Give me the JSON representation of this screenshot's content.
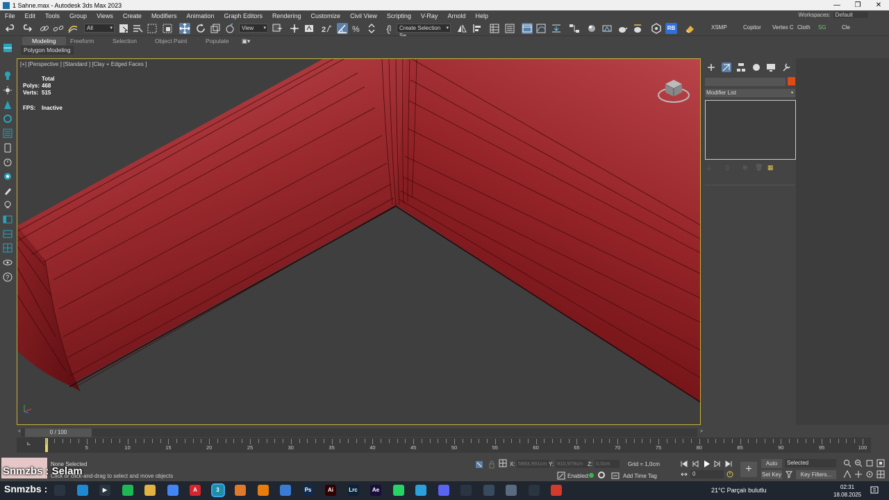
{
  "window": {
    "title": "1 Sahne.max - Autodesk 3ds Max 2023",
    "controls": [
      "—",
      "❐",
      "✕"
    ]
  },
  "menu": {
    "items": [
      "File",
      "Edit",
      "Tools",
      "Group",
      "Views",
      "Create",
      "Modifiers",
      "Animation",
      "Graph Editors",
      "Rendering",
      "Customize",
      "Civil View",
      "Scripting",
      "V-Ray",
      "Arnold",
      "Help"
    ],
    "workspaces_label": "Workspaces:",
    "workspaces_value": "Default"
  },
  "toolbar": {
    "filter_value": "All",
    "coord_system": "View",
    "named_selection": "Create Selection Se",
    "right_labels": [
      "XSMP",
      "Copitor",
      "Vertex C",
      "Cloth",
      "SG",
      "Cle"
    ],
    "rb_label": "RB"
  },
  "ribbon": {
    "tabs": [
      "Modeling",
      "Freeform",
      "Selection",
      "Object Paint",
      "Populate"
    ],
    "active_tab": "Modeling",
    "subpanel": "Polygon Modeling"
  },
  "viewport": {
    "label": "[+] [Perspective ] [Standard ] [Clay + Edged Faces ]",
    "stats": {
      "header": "Total",
      "polys_label": "Polys:",
      "polys": "468",
      "verts_label": "Verts:",
      "verts": "515",
      "fps_label": "FPS:",
      "fps": "Inactive"
    },
    "object_color": "#9b2a2e",
    "background_color": "#3f3f3f"
  },
  "command_panel": {
    "color_swatch": "#e04a14",
    "modifier_list": "Modifier List"
  },
  "timeline": {
    "slider_label": "0 / 100",
    "ticks": [
      0,
      5,
      10,
      15,
      20,
      25,
      30,
      35,
      40,
      45,
      50,
      55,
      60,
      65,
      70,
      75,
      80,
      85,
      90,
      95,
      100
    ],
    "current_frame": 0
  },
  "status": {
    "message": "None Selected",
    "hint": "Click or click-and-drag to select and move objects",
    "x_label": "X:",
    "x_value": "5893,991cm",
    "y_label": "Y:",
    "y_value": "910,979cm",
    "z_label": "Z:",
    "z_value": "0,0cm",
    "grid": "Grid = 1,0cm",
    "enabled_label": "Enabled:",
    "add_time_tag": "Add Time Tag",
    "auto_key": "Auto Key",
    "set_key": "Set Key",
    "selected_dropdown": "Selected",
    "key_filters": "Key Filters...",
    "frame_field": "0"
  },
  "overlay": {
    "line1_a": "Snmzbs",
    "line1_b": ": Selam",
    "line2": "Snmzbs :"
  },
  "taskbar": {
    "weather": "21°C  Parçalı bulutlu",
    "time": "02:31",
    "date": "18.08.2025",
    "apps": [
      {
        "name": "search",
        "color": "#2b3542",
        "label": ""
      },
      {
        "name": "edge",
        "color": "#1f8ad2",
        "label": ""
      },
      {
        "name": "media",
        "color": "#2b3542",
        "label": "▶"
      },
      {
        "name": "spotify",
        "color": "#1db954",
        "label": ""
      },
      {
        "name": "explorer",
        "color": "#e3b341",
        "label": ""
      },
      {
        "name": "chrome",
        "color": "#4285f4",
        "label": ""
      },
      {
        "name": "acrobat",
        "color": "#d4262c",
        "label": "A"
      },
      {
        "name": "3dsmax",
        "color": "#1d8ea8",
        "label": "3"
      },
      {
        "name": "sublime",
        "color": "#e07a2a",
        "label": ""
      },
      {
        "name": "blender",
        "color": "#e87d0d",
        "label": ""
      },
      {
        "name": "vmware",
        "color": "#3a7bd5",
        "label": ""
      },
      {
        "name": "photoshop",
        "color": "#0f2a4a",
        "label": "Ps"
      },
      {
        "name": "illustrator",
        "color": "#300",
        "label": "Ai"
      },
      {
        "name": "lightroom",
        "color": "#0b2238",
        "label": "Lrc"
      },
      {
        "name": "aftereffects",
        "color": "#1a0d3a",
        "label": "Ae"
      },
      {
        "name": "whatsapp",
        "color": "#25d366",
        "label": ""
      },
      {
        "name": "telegram",
        "color": "#2aa1da",
        "label": ""
      },
      {
        "name": "discord",
        "color": "#5865f2",
        "label": ""
      },
      {
        "name": "remote",
        "color": "#2b3542",
        "label": ""
      },
      {
        "name": "calculator",
        "color": "#3a4a5e",
        "label": ""
      },
      {
        "name": "app2",
        "color": "#5a6b80",
        "label": ""
      },
      {
        "name": "app3",
        "color": "#2b3542",
        "label": ""
      },
      {
        "name": "app4",
        "color": "#d23b2c",
        "label": ""
      }
    ]
  }
}
